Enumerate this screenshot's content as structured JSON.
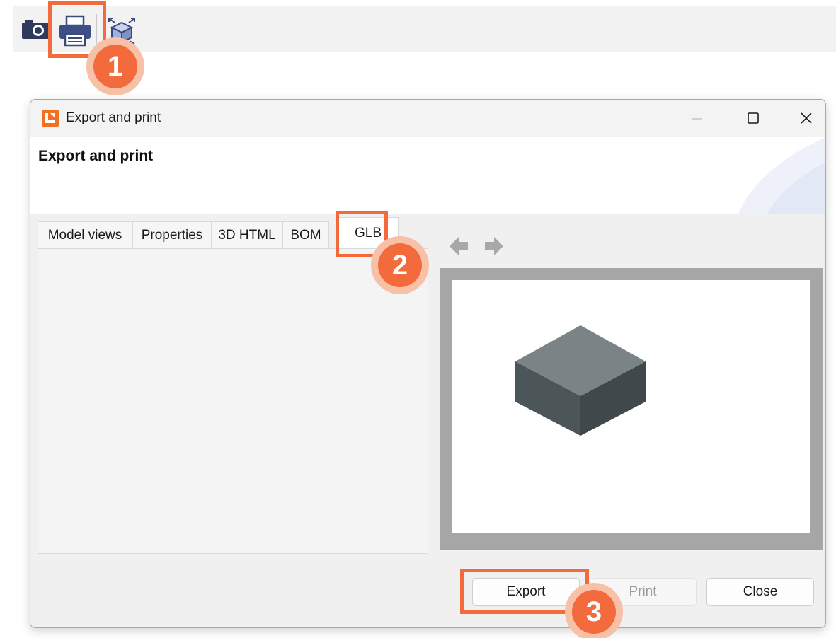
{
  "toolbar": {
    "icons": [
      "camera-icon",
      "printer-icon",
      "cube-explode-icon"
    ]
  },
  "callouts": [
    "1",
    "2",
    "3"
  ],
  "dialog": {
    "window_title": "Export and print",
    "header_title": "Export and print",
    "tabs": [
      {
        "label": "Model views"
      },
      {
        "label": "Properties"
      },
      {
        "label": "3D HTML"
      },
      {
        "label": "BOM"
      },
      {
        "label": "GLB"
      }
    ],
    "active_tab": "GLB",
    "buttons": {
      "export": "Export",
      "print": "Print",
      "close": "Close"
    }
  },
  "colors": {
    "accent": "#f36a3c",
    "accent_light": "#f8c0a6",
    "app_icon": "#f37021",
    "cube_top": "#7a8487",
    "cube_left": "#4c5558",
    "cube_right": "#40484b"
  }
}
